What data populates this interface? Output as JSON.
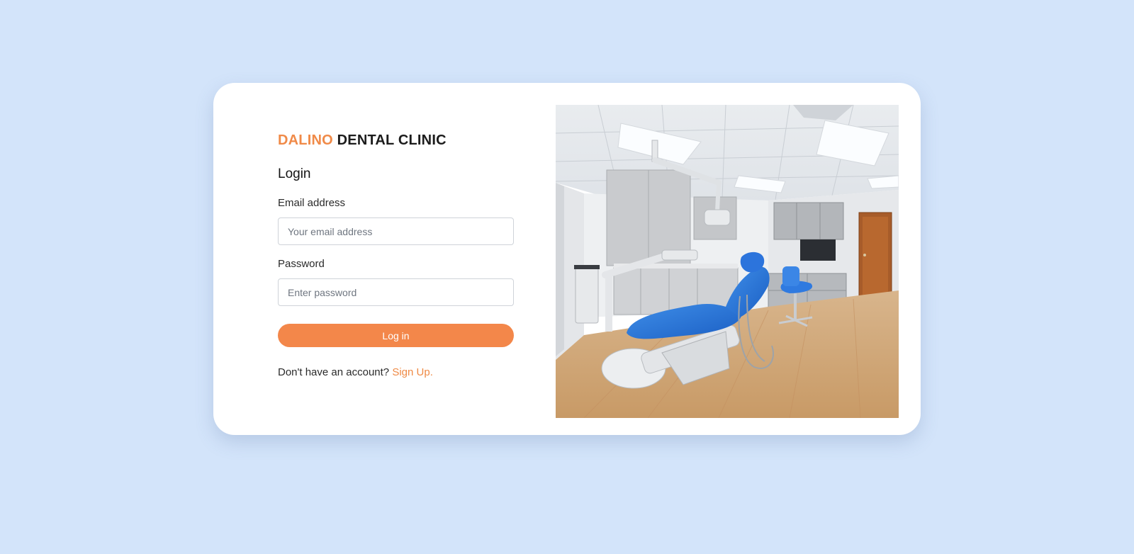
{
  "brand": {
    "accent_text": "DALINO",
    "rest_text": "DENTAL CLINIC"
  },
  "form": {
    "title": "Login",
    "email": {
      "label": "Email address",
      "value": "",
      "placeholder": "Your email address"
    },
    "password": {
      "label": "Password",
      "value": "",
      "placeholder": "Enter password"
    },
    "submit_label": "Log in",
    "signup_prompt": "Don't have an account?",
    "signup_link": "Sign Up."
  },
  "colors": {
    "page_background": "#d3e4fa",
    "accent": "#f3874a",
    "card_background": "#ffffff"
  },
  "hero_image": {
    "alt": "dental clinic treatment room"
  }
}
